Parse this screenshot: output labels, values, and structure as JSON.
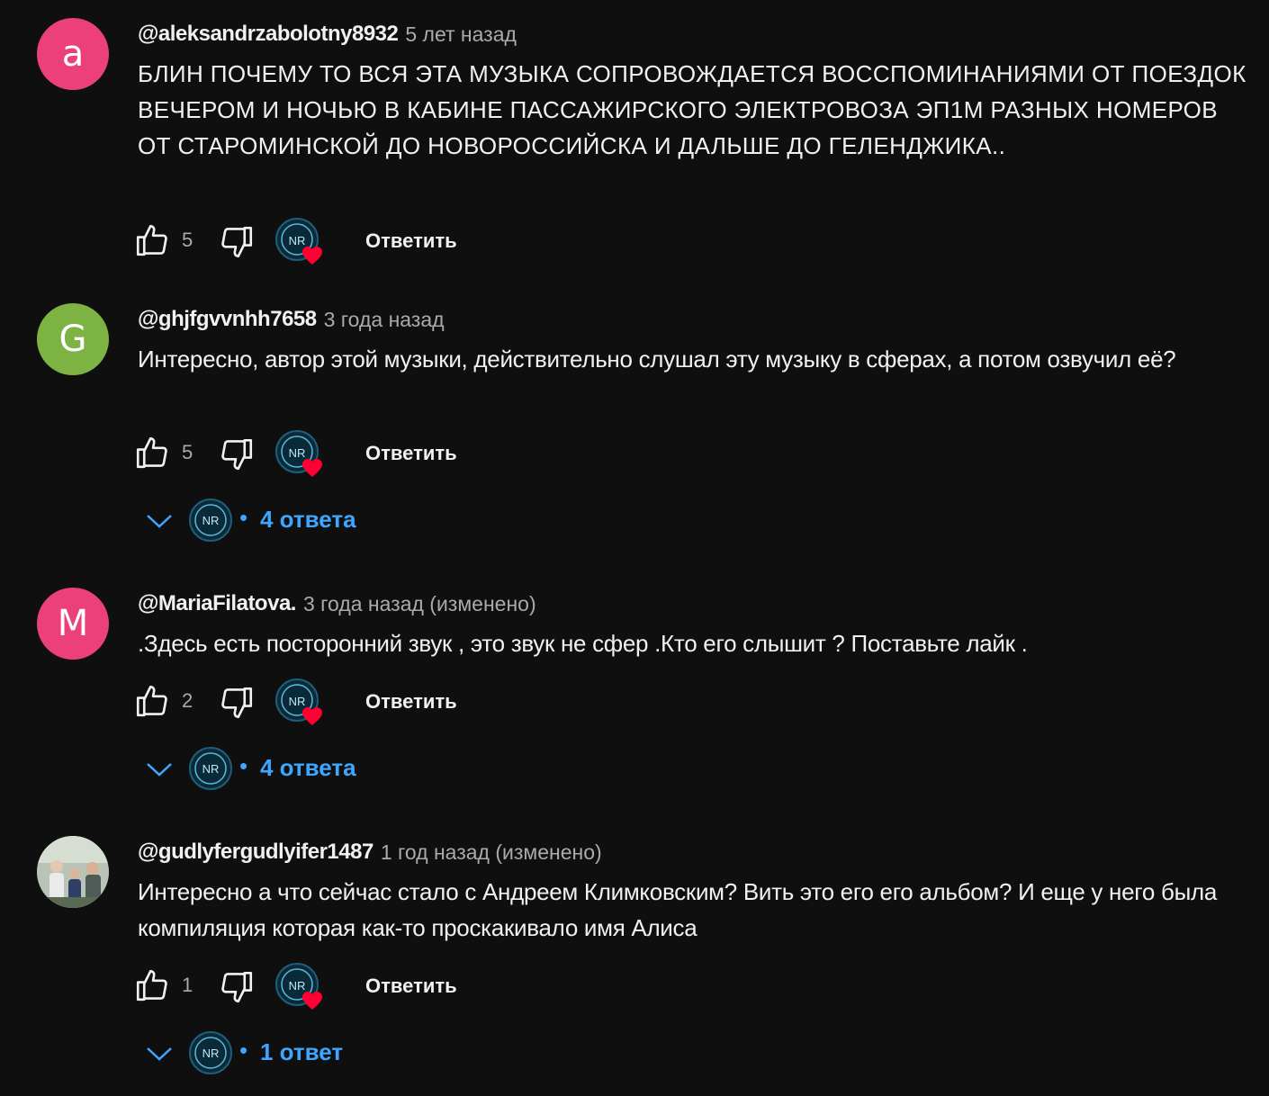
{
  "colors": {
    "background": "#0f0f0f",
    "text": "#f1f1f1",
    "muted": "#aaaaaa",
    "link": "#3ea6ff",
    "heart": "#ff0033"
  },
  "comments": [
    {
      "avatar_letter": "a",
      "avatar_color": "#ec407a",
      "author": "@aleksandrzabolotny8932",
      "time": "5 лет назад",
      "text": "БЛИН ПОЧЕМУ ТО ВСЯ ЭТА МУЗЫКА СОПРОВОЖДАЕТСЯ ВОССПОМИНАНИЯМИ ОТ ПОЕЗДОК ВЕЧЕРОМ И НОЧЬЮ В КАБИНЕ ПАССАЖИРСКОГО ЭЛЕКТРОВОЗА ЭП1М РАЗНЫХ НОМЕРОВ ОТ СТАРОМИНСКОЙ ДО НОВОРОССИЙСКА И ДАЛЬШЕ ДО ГЕЛЕНДЖИКА..",
      "likes": "5",
      "reply_label": "Ответить"
    },
    {
      "avatar_letter": "G",
      "avatar_color": "#7cb342",
      "author": "@ghjfgvvnhh7658",
      "time": "3 года назад",
      "text": "Интересно, автор этой музыки, действительно слушал эту музыку в сферах, а потом озвучил её?",
      "likes": "5",
      "reply_label": "Ответить",
      "replies": "4 ответа"
    },
    {
      "avatar_letter": "M",
      "avatar_color": "#ec407a",
      "author": "@MariaFilatova.",
      "time": "3 года назад (изменено)",
      "text": ".Здесь есть посторонний звук , это звук не сфер .Кто его слышит ? Поставьте лайк .",
      "likes": "2",
      "reply_label": "Ответить",
      "replies": "4 ответа"
    },
    {
      "avatar_letter": "",
      "avatar_color": "#8a978c",
      "author": "@gudlyfergudlyifer1487",
      "time": "1 год назад (изменено)",
      "text": "Интересно а что сейчас стало с Андреем Климковским? Вить это его его альбом? И еще у него была компиляция которая как-то  проскакивало имя Алиса",
      "likes": "1",
      "reply_label": "Ответить",
      "replies": "1 ответ"
    }
  ],
  "creator_badge": {
    "initials": "NR"
  }
}
